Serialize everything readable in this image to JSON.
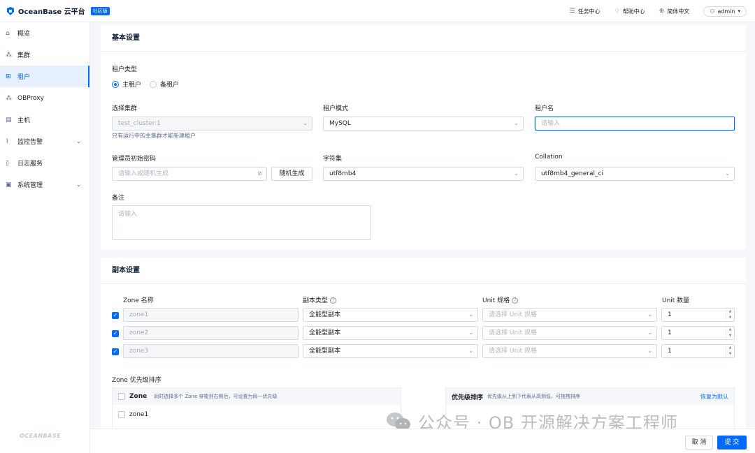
{
  "header": {
    "logo_text": "OceanBase 云平台",
    "edition_badge": "社区版",
    "task_center": "任务中心",
    "help_center": "帮助中心",
    "language": "简体中文",
    "user": "admin"
  },
  "sidebar": {
    "items": [
      {
        "label": "概览",
        "icon": "home-icon"
      },
      {
        "label": "集群",
        "icon": "cluster-icon"
      },
      {
        "label": "租户",
        "icon": "tenant-icon",
        "active": true
      },
      {
        "label": "OBProxy",
        "icon": "proxy-icon"
      },
      {
        "label": "主机",
        "icon": "host-icon"
      },
      {
        "label": "监控告警",
        "icon": "monitor-icon",
        "expandable": true
      },
      {
        "label": "日志服务",
        "icon": "log-icon"
      },
      {
        "label": "系统管理",
        "icon": "system-icon",
        "expandable": true
      }
    ],
    "footer_logo": "OCEANBASE"
  },
  "basic": {
    "title": "基本设置",
    "tenant_type_label": "租户类型",
    "primary_tenant": "主租户",
    "standby_tenant": "备租户",
    "cluster_label": "选择集群",
    "cluster_value": "test_cluster:1",
    "cluster_hint": "只有运行中的主集群才能新建租户",
    "mode_label": "租户模式",
    "mode_value": "MySQL",
    "name_label": "租户名",
    "name_placeholder": "请输入",
    "password_label": "管理员初始密码",
    "password_placeholder": "请输入或随机生成",
    "random_button": "随机生成",
    "charset_label": "字符集",
    "charset_value": "utf8mb4",
    "collation_label": "Collation",
    "collation_value": "utf8mb4_general_ci",
    "remark_label": "备注",
    "remark_placeholder": "请输入"
  },
  "replica": {
    "title": "副本设置",
    "col_zone": "Zone 名称",
    "col_type": "副本类型",
    "col_unit": "Unit 规格",
    "col_count": "Unit 数量",
    "unit_placeholder": "请选择 Unit 规格",
    "rows": [
      {
        "zone": "zone1",
        "type": "全能型副本",
        "count": "1"
      },
      {
        "zone": "zone2",
        "type": "全能型副本",
        "count": "1"
      },
      {
        "zone": "zone3",
        "type": "全能型副本",
        "count": "1"
      }
    ],
    "priority_title": "Zone 优先级排序",
    "left_head": "Zone",
    "left_hint": "同时选择多个 Zone 穿梭到右侧后，可设置为同一优先级",
    "left_item": "zone1",
    "right_head": "优先级排序",
    "right_hint": "优先级从上到下代表从高到低，可拖拽排序",
    "reset_link": "恢复为默认"
  },
  "watermark": "公众号 · OB 开源解决方案工程师",
  "footer": {
    "cancel": "取 消",
    "submit": "提 交"
  }
}
